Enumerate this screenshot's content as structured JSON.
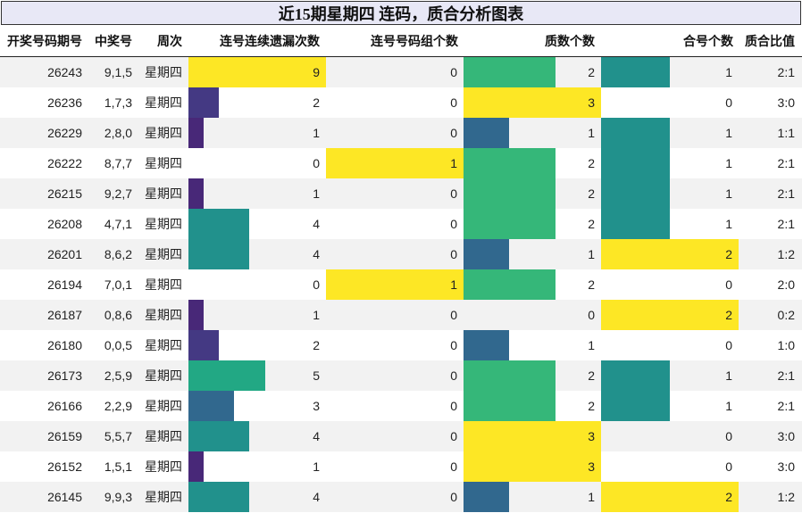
{
  "title": "近15期星期四 连码，质合分析图表",
  "headers": {
    "issue": "开奖号码期号",
    "numbers": "中奖号",
    "weekday": "周次",
    "consecutive_miss": "连号连续遗漏次数",
    "consecutive_groups": "连号号码组个数",
    "prime_count": "质数个数",
    "composite_count": "合号个数",
    "ratio": "质合比值"
  },
  "colors": {
    "yellow": "#fde725",
    "green": "#35b779",
    "teal": "#21918c",
    "blue": "#31688e",
    "indigo": "#443983",
    "purple": "#482878",
    "row_alt": "#f2f2f2",
    "title_bg": "#e8e8f6"
  },
  "rows": [
    {
      "issue": "26243",
      "numbers": "9,1,5",
      "weekday": "星期四",
      "miss": 9,
      "groups": 0,
      "prime": 2,
      "composite": 1,
      "ratio": "2:1"
    },
    {
      "issue": "26236",
      "numbers": "1,7,3",
      "weekday": "星期四",
      "miss": 2,
      "groups": 0,
      "prime": 3,
      "composite": 0,
      "ratio": "3:0"
    },
    {
      "issue": "26229",
      "numbers": "2,8,0",
      "weekday": "星期四",
      "miss": 1,
      "groups": 0,
      "prime": 1,
      "composite": 1,
      "ratio": "1:1"
    },
    {
      "issue": "26222",
      "numbers": "8,7,7",
      "weekday": "星期四",
      "miss": 0,
      "groups": 1,
      "prime": 2,
      "composite": 1,
      "ratio": "2:1"
    },
    {
      "issue": "26215",
      "numbers": "9,2,7",
      "weekday": "星期四",
      "miss": 1,
      "groups": 0,
      "prime": 2,
      "composite": 1,
      "ratio": "2:1"
    },
    {
      "issue": "26208",
      "numbers": "4,7,1",
      "weekday": "星期四",
      "miss": 4,
      "groups": 0,
      "prime": 2,
      "composite": 1,
      "ratio": "2:1"
    },
    {
      "issue": "26201",
      "numbers": "8,6,2",
      "weekday": "星期四",
      "miss": 4,
      "groups": 0,
      "prime": 1,
      "composite": 2,
      "ratio": "1:2"
    },
    {
      "issue": "26194",
      "numbers": "7,0,1",
      "weekday": "星期四",
      "miss": 0,
      "groups": 1,
      "prime": 2,
      "composite": 0,
      "ratio": "2:0"
    },
    {
      "issue": "26187",
      "numbers": "0,8,6",
      "weekday": "星期四",
      "miss": 1,
      "groups": 0,
      "prime": 0,
      "composite": 2,
      "ratio": "0:2"
    },
    {
      "issue": "26180",
      "numbers": "0,0,5",
      "weekday": "星期四",
      "miss": 2,
      "groups": 0,
      "prime": 1,
      "composite": 0,
      "ratio": "1:0"
    },
    {
      "issue": "26173",
      "numbers": "2,5,9",
      "weekday": "星期四",
      "miss": 5,
      "groups": 0,
      "prime": 2,
      "composite": 1,
      "ratio": "2:1"
    },
    {
      "issue": "26166",
      "numbers": "2,2,9",
      "weekday": "星期四",
      "miss": 3,
      "groups": 0,
      "prime": 2,
      "composite": 1,
      "ratio": "2:1"
    },
    {
      "issue": "26159",
      "numbers": "5,5,7",
      "weekday": "星期四",
      "miss": 4,
      "groups": 0,
      "prime": 3,
      "composite": 0,
      "ratio": "3:0"
    },
    {
      "issue": "26152",
      "numbers": "1,5,1",
      "weekday": "星期四",
      "miss": 1,
      "groups": 0,
      "prime": 3,
      "composite": 0,
      "ratio": "3:0"
    },
    {
      "issue": "26145",
      "numbers": "9,9,3",
      "weekday": "星期四",
      "miss": 4,
      "groups": 0,
      "prime": 1,
      "composite": 2,
      "ratio": "1:2"
    }
  ]
}
